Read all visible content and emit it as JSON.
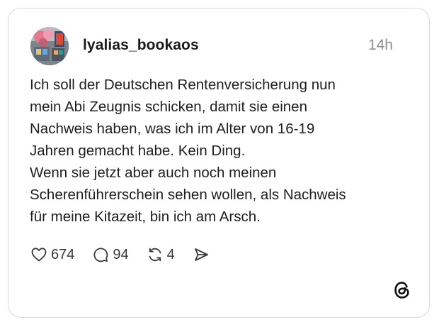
{
  "post": {
    "username": "lyalias_bookaos",
    "timestamp": "14h",
    "body_lines": [
      "Ich soll der Deutschen Rentenversicherung nun",
      "mein Abi Zeugnis schicken, damit sie einen",
      "Nachweis haben, was ich im Alter von 16-19",
      "Jahren gemacht habe. Kein Ding.",
      "Wenn sie jetzt aber auch noch meinen",
      "Scherenführerschein sehen wollen, als Nachweis",
      "für meine Kitazeit, bin ich am Arsch."
    ]
  },
  "actions": {
    "like": {
      "icon": "heart-icon",
      "count": "674"
    },
    "comment": {
      "icon": "comment-icon",
      "count": "94"
    },
    "repost": {
      "icon": "repost-icon",
      "count": "4"
    },
    "share": {
      "icon": "share-icon"
    }
  },
  "branding": {
    "icon": "threads-logo-icon"
  },
  "colors": {
    "text": "#202020",
    "muted": "#8e8e8e",
    "border": "#d9d9d9",
    "icon": "#3a3a3a"
  }
}
